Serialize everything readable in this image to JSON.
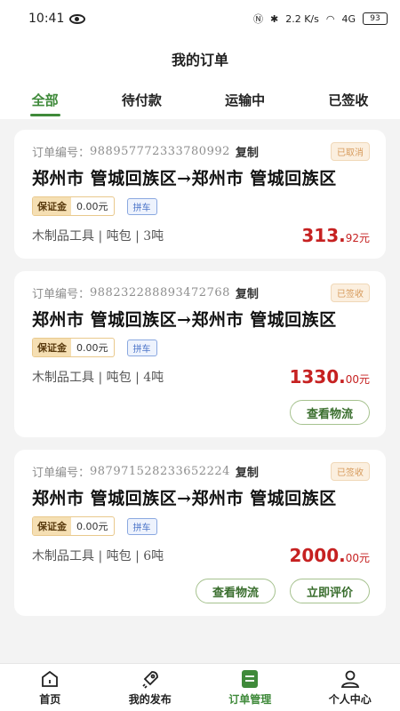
{
  "status_bar": {
    "time": "10:41",
    "signal_text": "2.2 K/s",
    "network": "4G",
    "battery": "93"
  },
  "header": {
    "title": "我的订单"
  },
  "tabs": [
    {
      "label": "全部",
      "active": true
    },
    {
      "label": "待付款",
      "active": false
    },
    {
      "label": "运输中",
      "active": false
    },
    {
      "label": "已签收",
      "active": false
    }
  ],
  "orders": [
    {
      "order_label": "订单编号：",
      "order_no": "988957772333780992",
      "copy_label": "复制",
      "status": "已取消",
      "route": "郑州市 管城回族区→郑州市 管城回族区",
      "deposit_label": "保证金",
      "deposit_value": "0.00元",
      "pool_tag": "拼车",
      "goods": "木制品工具 | 吨包 | 3吨",
      "price_int": "313.",
      "price_dec": "92元",
      "actions": []
    },
    {
      "order_label": "订单编号：",
      "order_no": "988232288893472768",
      "copy_label": "复制",
      "status": "已签收",
      "route": "郑州市 管城回族区→郑州市 管城回族区",
      "deposit_label": "保证金",
      "deposit_value": "0.00元",
      "pool_tag": "拼车",
      "goods": "木制品工具 | 吨包 | 4吨",
      "price_int": "1330.",
      "price_dec": "00元",
      "actions": [
        "查看物流"
      ]
    },
    {
      "order_label": "订单编号：",
      "order_no": "987971528233652224",
      "copy_label": "复制",
      "status": "已签收",
      "route": "郑州市 管城回族区→郑州市 管城回族区",
      "deposit_label": "保证金",
      "deposit_value": "0.00元",
      "pool_tag": "拼车",
      "goods": "木制品工具 | 吨包 | 6吨",
      "price_int": "2000.",
      "price_dec": "00元",
      "actions": [
        "查看物流",
        "立即评价"
      ]
    }
  ],
  "bottom_nav": [
    {
      "label": "首页",
      "icon": "home-icon",
      "active": false
    },
    {
      "label": "我的发布",
      "icon": "rocket-icon",
      "active": false
    },
    {
      "label": "订单管理",
      "icon": "order-list-icon",
      "active": true
    },
    {
      "label": "个人中心",
      "icon": "person-icon",
      "active": false
    }
  ],
  "colors": {
    "accent": "#3f8a3a",
    "price": "#c62121",
    "badge_bg": "#fbefdf"
  }
}
